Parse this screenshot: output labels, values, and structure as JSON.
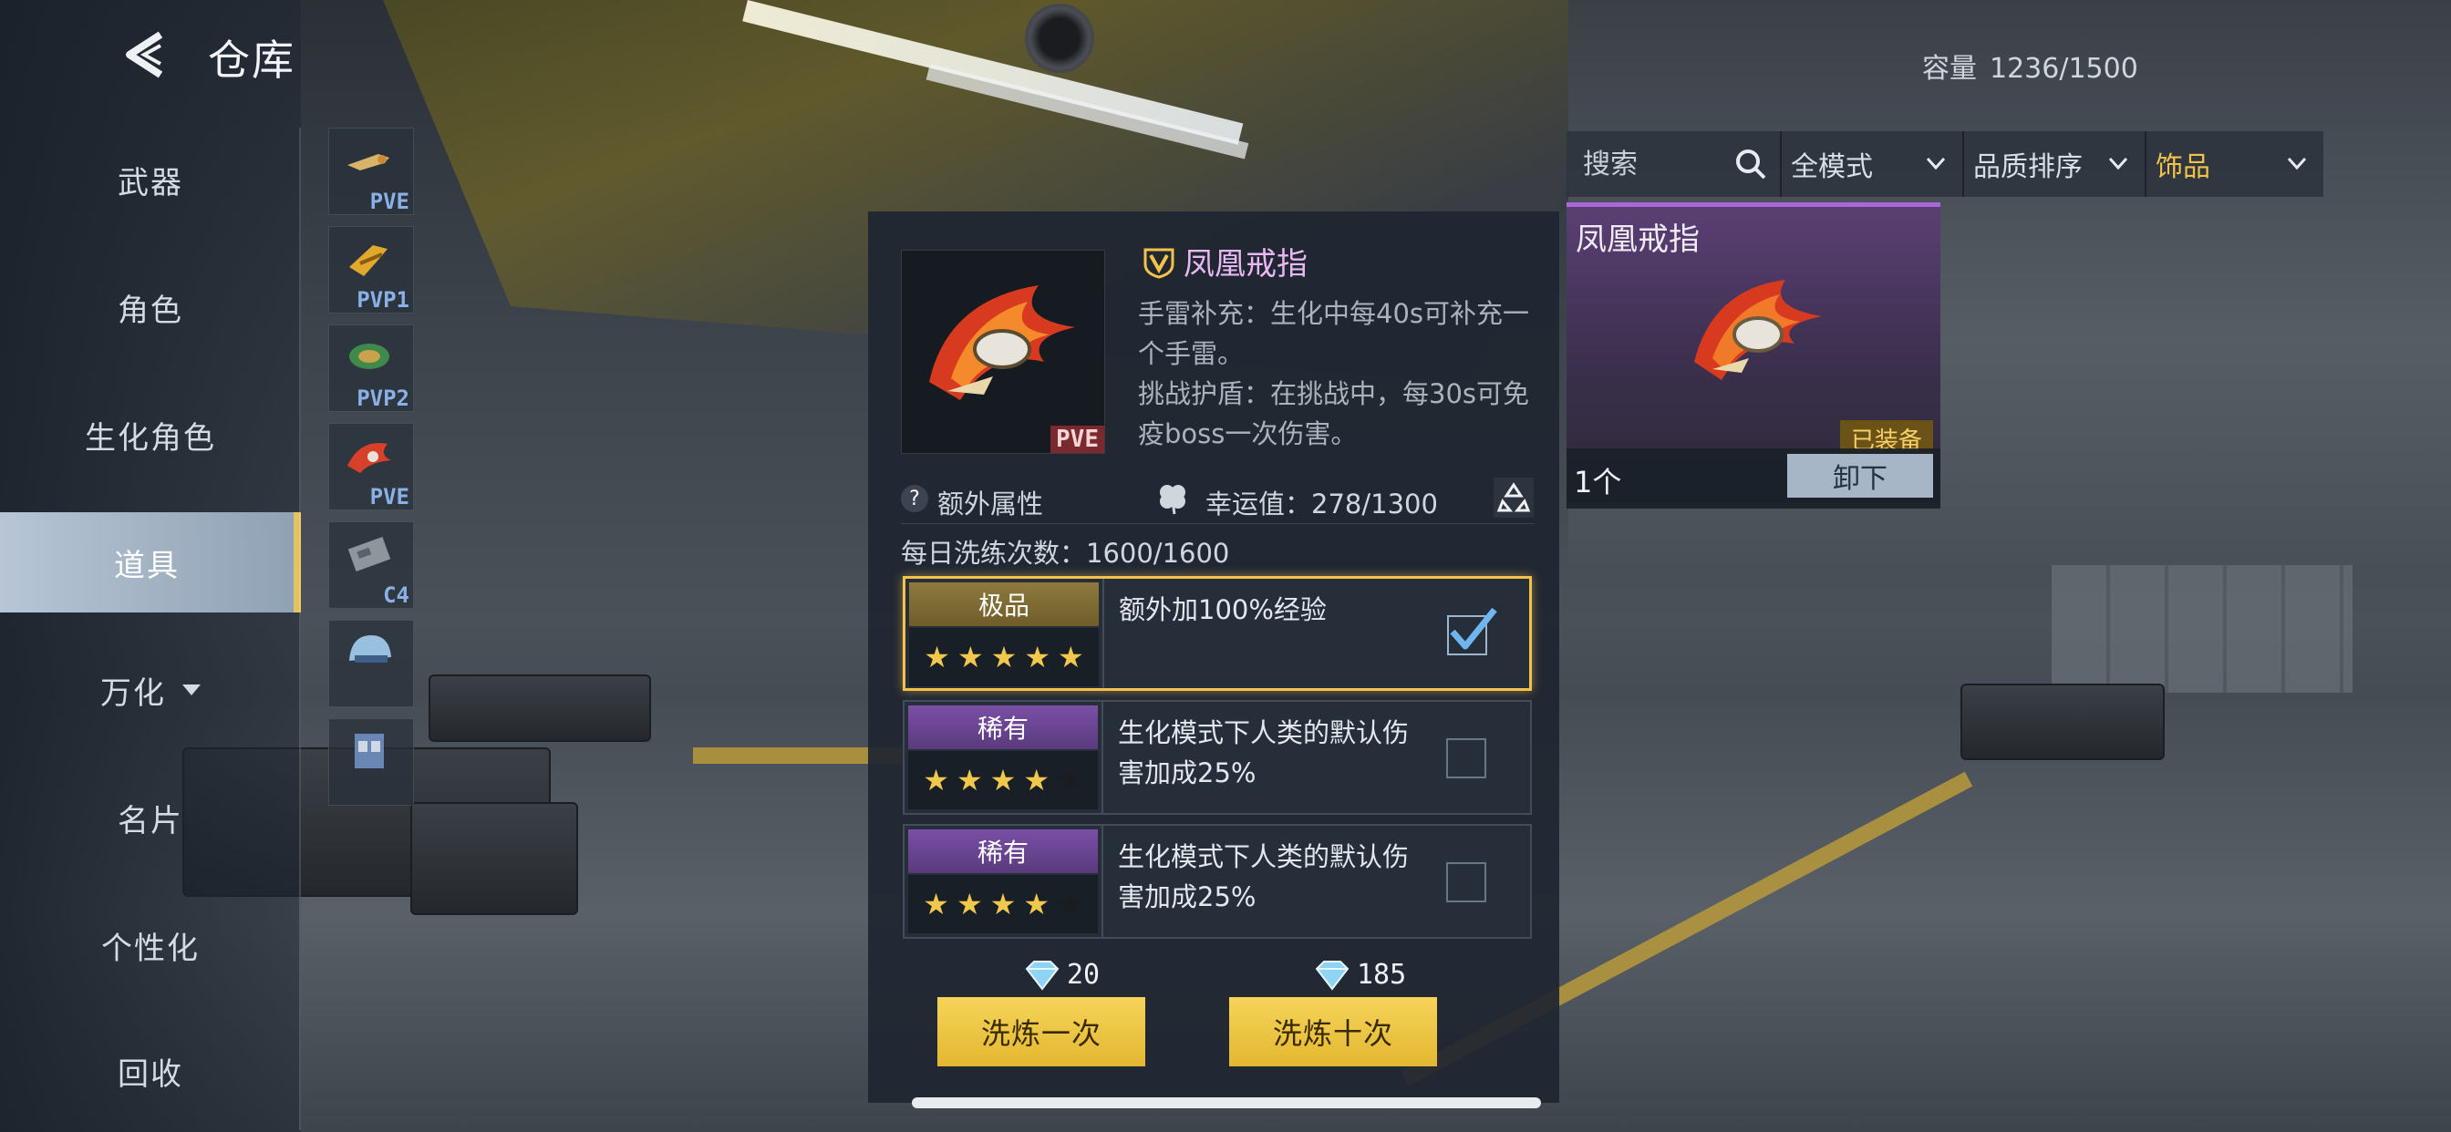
{
  "header": {
    "title": "仓库"
  },
  "capacity": {
    "label": "容量",
    "value": "1236/1500"
  },
  "nav": {
    "items": [
      {
        "label": "武器"
      },
      {
        "label": "角色"
      },
      {
        "label": "生化角色"
      },
      {
        "label": "道具",
        "active": true
      },
      {
        "label": "万化"
      },
      {
        "label": "名片"
      },
      {
        "label": "个性化"
      },
      {
        "label": "回收"
      }
    ]
  },
  "thumbs": [
    {
      "tag": "PVE",
      "icon": "gun-charm-icon"
    },
    {
      "tag": "PVP1",
      "icon": "gold-gun-icon"
    },
    {
      "tag": "PVP2",
      "icon": "green-emblem-icon"
    },
    {
      "tag": "PVE",
      "icon": "phoenix-ring-icon"
    },
    {
      "tag": "C4",
      "icon": "c4-icon"
    },
    {
      "tag": "",
      "icon": "helmet-icon"
    },
    {
      "tag": "",
      "icon": "chest-rig-icon"
    }
  ],
  "filters": {
    "search_placeholder": "搜索",
    "mode": "全模式",
    "sort": "品质排序",
    "category": "饰品"
  },
  "equipped": {
    "name": "凤凰戒指",
    "badge": "已装备",
    "count": "1个",
    "unequip_label": "卸下"
  },
  "detail": {
    "name": "凤凰戒指",
    "tag": "PVE",
    "desc1": "手雷补充：生化中每40s可补充一个手雷。",
    "desc2": "挑战护盾：在挑战中，每30s可免疫boss一次伤害。",
    "extra_attr": "额外属性",
    "luck": "幸运值：278/1300",
    "daily_refine": "每日洗练次数：1600/1600"
  },
  "traits": [
    {
      "grade": "极品",
      "grade_color": "#8e7a3e",
      "stars": 5,
      "text": "额外加100%经验",
      "checked": true
    },
    {
      "grade": "稀有",
      "grade_color": "#7a4fa6",
      "stars": 4,
      "text": "生化模式下人类的默认伤害加成25%",
      "checked": false
    },
    {
      "grade": "稀有",
      "grade_color": "#7a4fa6",
      "stars": 4,
      "text": "生化模式下人类的默认伤害加成25%",
      "checked": false
    }
  ],
  "actions": {
    "cost_once": "20",
    "cost_ten": "185",
    "refine_once": "洗炼一次",
    "refine_ten": "洗炼十次"
  }
}
